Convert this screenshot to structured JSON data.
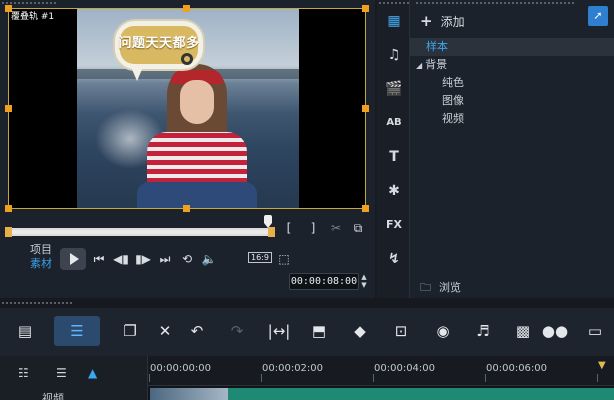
{
  "preview": {
    "clip_label": "覆叠轨 #1",
    "speech_text": "问题天天都多",
    "mode_project": "项目",
    "mode_clip": "素材",
    "aspect": "16:9",
    "timecode": "00:00:08:00",
    "brackets": "[   ]"
  },
  "library": {
    "add_label": "添加",
    "items": [
      "样本",
      "背景",
      "纯色",
      "图像",
      "视频"
    ],
    "browse_label": "浏览",
    "side_icons": [
      "media-icon",
      "audio-icon",
      "instant-project-icon",
      "transition-icon",
      "title-icon",
      "graphics-icon",
      "filter-icon",
      "path-icon"
    ]
  },
  "toolbar": {
    "icons": [
      "storyboard-icon",
      "timeline-view-icon",
      "copy-attributes-icon",
      "tools-icon",
      "undo-icon",
      "redo-icon",
      "fit-icon",
      "crop-icon",
      "split-icon",
      "trim-icon",
      "record-icon",
      "audio-mix-icon",
      "motion-icon",
      "mask-icon",
      "subtitle-icon"
    ]
  },
  "timeline": {
    "ruler": [
      "00:00:00:00",
      "00:00:02:00",
      "00:00:04:00",
      "00:00:06:00"
    ],
    "track_label": "视频"
  },
  "colors": {
    "accent": "#3aa7f0",
    "handle": "#f0a020",
    "clip": "#1f8a73"
  }
}
